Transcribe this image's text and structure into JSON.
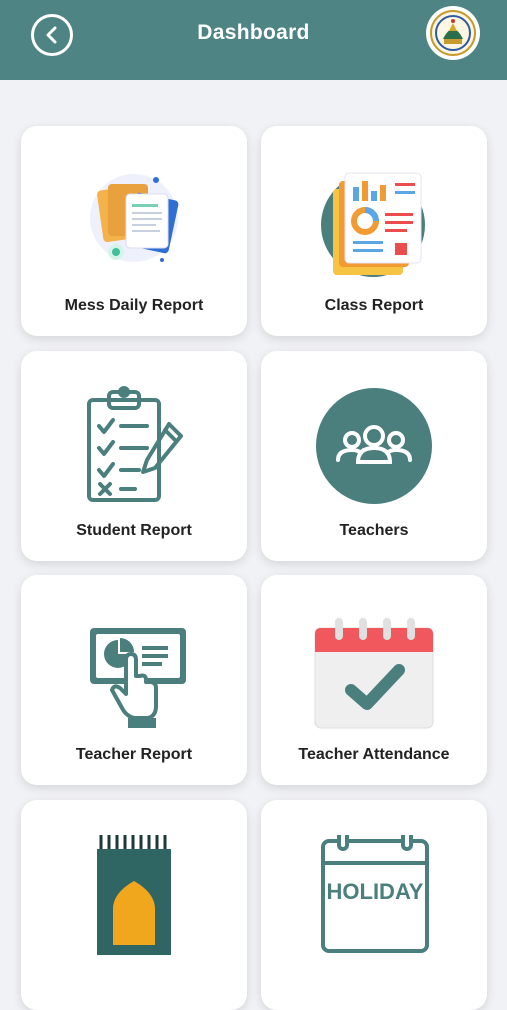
{
  "header": {
    "title": "Dashboard"
  },
  "cards": [
    {
      "label": "Mess Daily Report",
      "icon": "documents-icon"
    },
    {
      "label": "Class Report",
      "icon": "report-chart-icon"
    },
    {
      "label": "Student Report",
      "icon": "clipboard-checklist-icon"
    },
    {
      "label": "Teachers",
      "icon": "group-people-icon"
    },
    {
      "label": "Teacher Report",
      "icon": "presentation-touch-icon"
    },
    {
      "label": "Teacher Attendance",
      "icon": "calendar-check-icon"
    },
    {
      "label": "",
      "icon": "prayer-mat-icon"
    },
    {
      "label": "",
      "icon": "holiday-calendar-icon"
    }
  ],
  "calendar_text": "HOLIDAY",
  "colors": {
    "header": "#4e8584",
    "teal": "#4a7f7e",
    "card": "#ffffff",
    "background": "#f1f2f6"
  }
}
